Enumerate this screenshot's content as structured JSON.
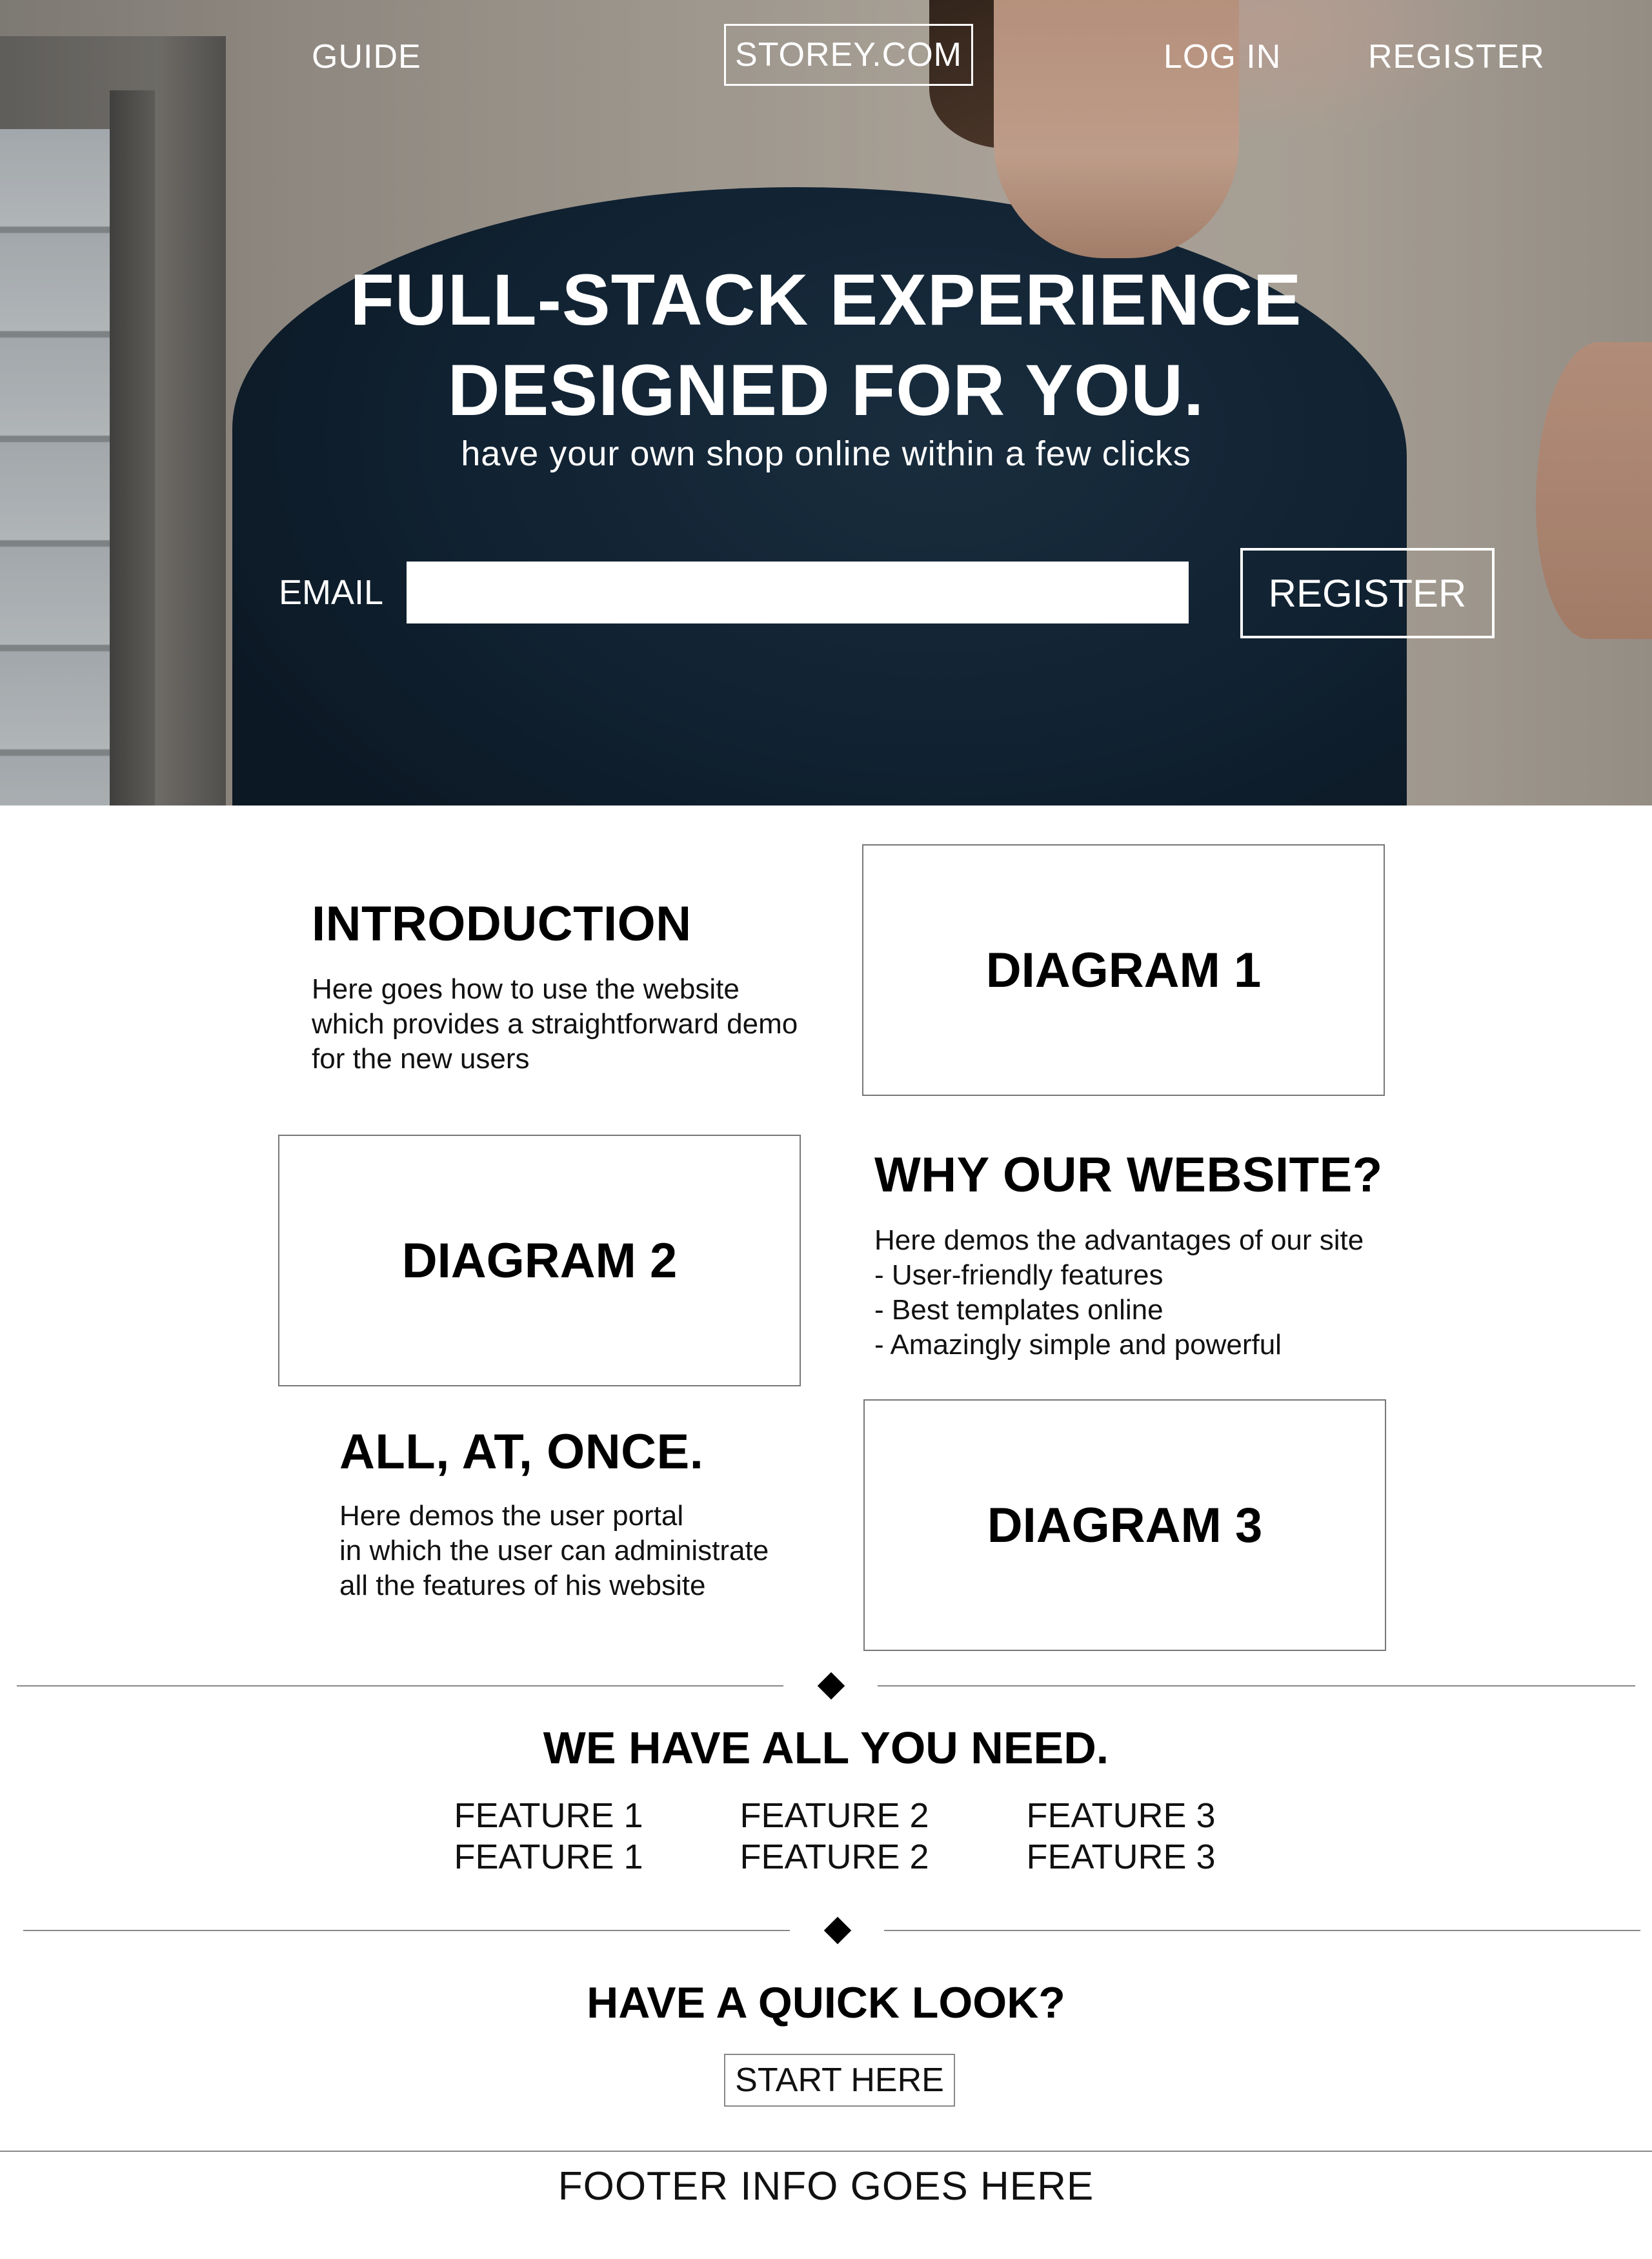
{
  "nav": {
    "guide": "GUIDE",
    "brand": "STOREY.COM",
    "login": "LOG IN",
    "register": "REGISTER"
  },
  "hero": {
    "title_line1": "FULL-STACK EXPERIENCE",
    "title_line2": "DESIGNED FOR YOU.",
    "subtitle": "have your own shop online within a few clicks",
    "email_label": "EMAIL",
    "email_value": "",
    "register_button": "REGISTER"
  },
  "sections": {
    "introduction": {
      "heading": "INTRODUCTION",
      "lines": [
        "Here goes how to use the website",
        "which provides a straightforward demo",
        "for the new users"
      ]
    },
    "why": {
      "heading": "WHY OUR WEBSITE?",
      "lines": [
        "Here demos the advantages of our site",
        "- User-friendly features",
        "- Best templates online",
        "- Amazingly simple and powerful"
      ]
    },
    "all_at_once": {
      "heading": "ALL, AT, ONCE.",
      "lines": [
        "Here demos the user portal",
        "in which the user can administrate",
        "all the features of his website"
      ]
    },
    "diagrams": [
      "DIAGRAM 1",
      "DIAGRAM 2",
      "DIAGRAM 3"
    ]
  },
  "features": {
    "heading": "WE HAVE ALL YOU NEED.",
    "columns": [
      [
        "FEATURE 1",
        "FEATURE 1"
      ],
      [
        "FEATURE 2",
        "FEATURE 2"
      ],
      [
        "FEATURE 3",
        "FEATURE 3"
      ]
    ]
  },
  "quick_look": {
    "heading": "HAVE A QUICK LOOK?",
    "button": "START HERE"
  },
  "footer": {
    "text": "FOOTER INFO GOES HERE"
  }
}
